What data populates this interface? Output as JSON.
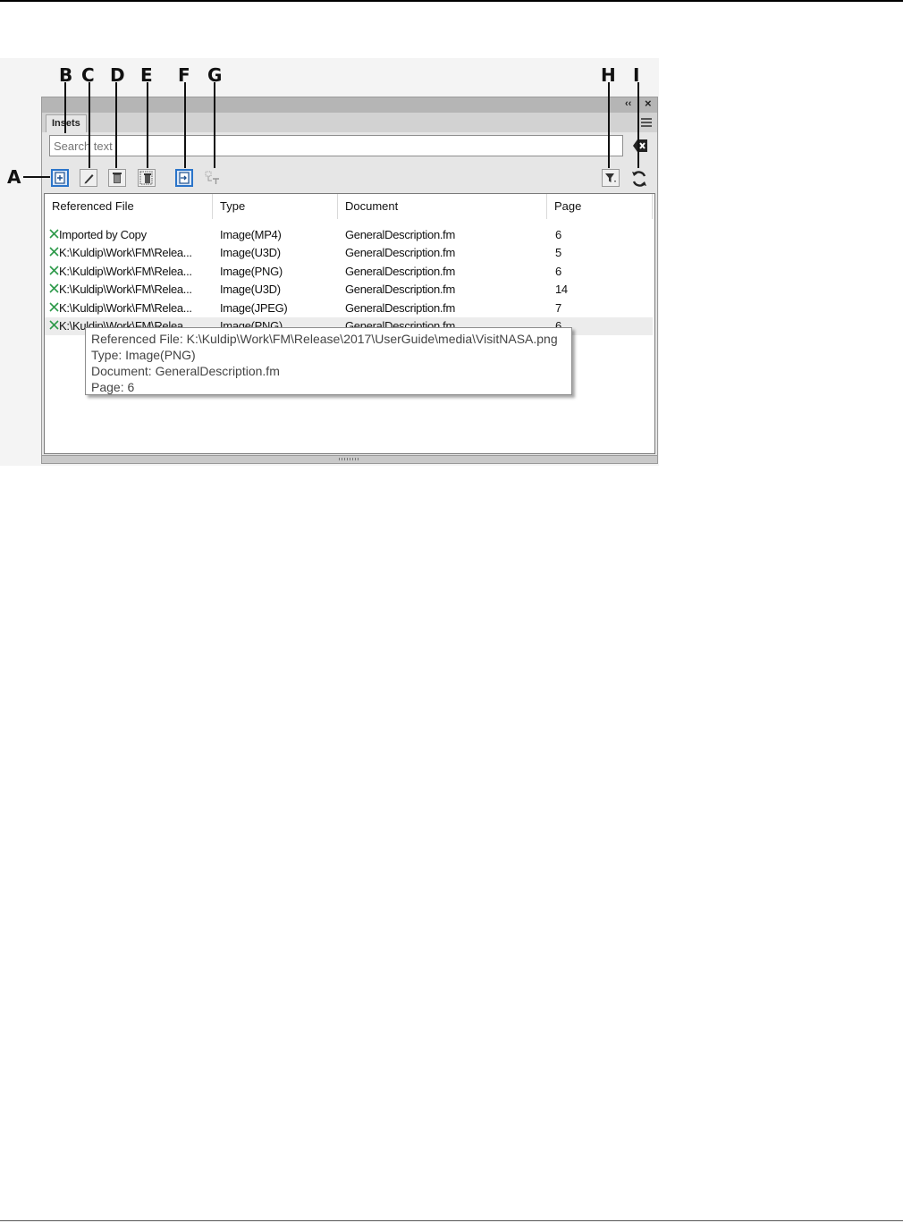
{
  "callouts": [
    "A",
    "B",
    "C",
    "D",
    "E",
    "F",
    "G",
    "H",
    "I"
  ],
  "panel": {
    "collapse_glyph": "‹‹",
    "close_glyph": "×",
    "tab_label": "Insets",
    "search_placeholder": "Search text"
  },
  "toolbar": {
    "icons": [
      "add-inset-icon",
      "edit-icon",
      "delete-icon",
      "delete-all-icon",
      "import-icon",
      "text-icon",
      "filter-icon",
      "refresh-icon"
    ]
  },
  "columns": [
    "Referenced File",
    "Type",
    "Document",
    "Page"
  ],
  "rows": [
    {
      "file": "Imported by Copy",
      "type": "Image(MP4)",
      "document": "GeneralDescription.fm",
      "page": "6"
    },
    {
      "file": "K:\\Kuldip\\Work\\FM\\Relea...",
      "type": "Image(U3D)",
      "document": "GeneralDescription.fm",
      "page": "5"
    },
    {
      "file": "K:\\Kuldip\\Work\\FM\\Relea...",
      "type": "Image(PNG)",
      "document": "GeneralDescription.fm",
      "page": "6"
    },
    {
      "file": "K:\\Kuldip\\Work\\FM\\Relea...",
      "type": "Image(U3D)",
      "document": "GeneralDescription.fm",
      "page": "14"
    },
    {
      "file": "K:\\Kuldip\\Work\\FM\\Relea...",
      "type": "Image(JPEG)",
      "document": "GeneralDescription.fm",
      "page": "7"
    },
    {
      "file": "K:\\Kuldip\\Work\\FM\\Relea...",
      "type": "Image(PNG)",
      "document": "GeneralDescription.fm",
      "page": "6"
    }
  ],
  "tooltip": {
    "line1": "Referenced File: K:\\Kuldip\\Work\\FM\\Release\\2017\\UserGuide\\media\\VisitNASA.png",
    "line2": "Type: Image(PNG)",
    "line3": "Document: GeneralDescription.fm",
    "line4": "Page: 6"
  },
  "colors": {
    "active_blue": "#2a74c9",
    "link_icon_green": "#2e9a4a"
  }
}
